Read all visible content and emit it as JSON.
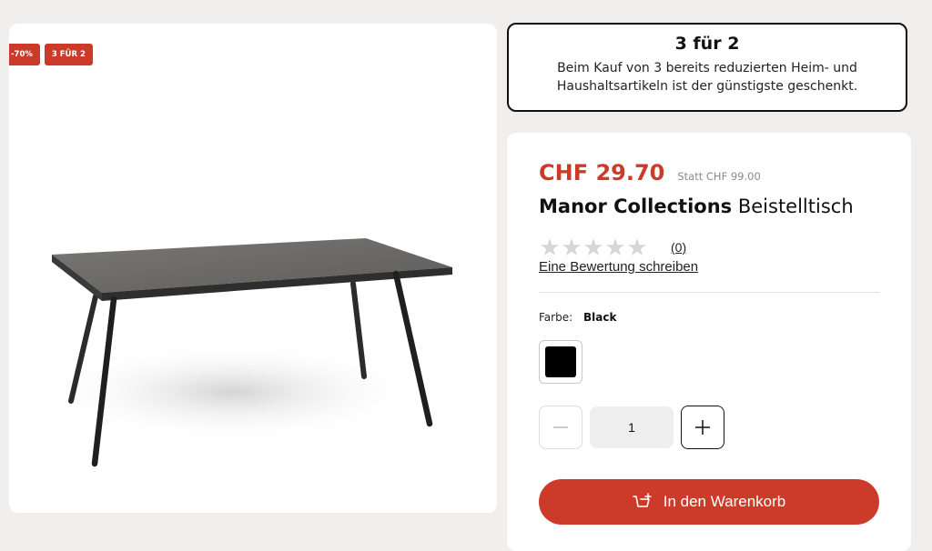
{
  "badges": {
    "discount": "-70%",
    "promo": "3 FÜR 2"
  },
  "promo": {
    "title": "3 für 2",
    "text": "Beim Kauf von 3 bereits reduzierten Heim- und Haushaltsartikeln ist der günstigste geschenkt."
  },
  "product": {
    "price": "CHF 29.70",
    "old_price": "Statt CHF 99.00",
    "brand": "Manor Collections",
    "name": "Beistelltisch",
    "rating": {
      "stars_filled": 0,
      "stars_total": 5,
      "count": "(0)",
      "write_review": "Eine Bewertung schreiben"
    },
    "color": {
      "label": "Farbe:",
      "value": "Black",
      "swatch_hex": "#000000"
    },
    "quantity": "1",
    "add_to_cart": "In den Warenkorb"
  },
  "colors": {
    "accent": "#cc3b2a",
    "background": "#f1efee"
  }
}
